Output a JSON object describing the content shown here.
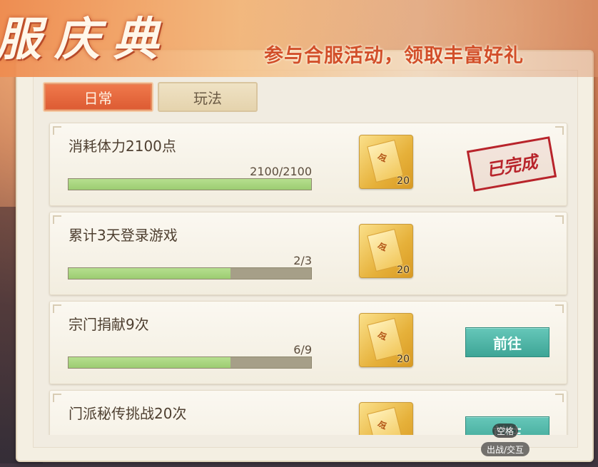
{
  "banner": {
    "title": "服庆典",
    "subtitle": "参与合服活动，领取丰富好礼"
  },
  "tabs": [
    {
      "label": "日常",
      "active": true
    },
    {
      "label": "玩法",
      "active": false
    }
  ],
  "tasks": [
    {
      "title": "消耗体力2100点",
      "progress_text": "2100/2100",
      "progress": 1.0,
      "reward_count": "20",
      "status": "completed",
      "stamp_text": "已完成"
    },
    {
      "title": "累计3天登录游戏",
      "progress_text": "2/3",
      "progress": 0.667,
      "reward_count": "20",
      "status": "in_progress"
    },
    {
      "title": "宗门捐献9次",
      "progress_text": "6/9",
      "progress": 0.667,
      "reward_count": "20",
      "status": "go",
      "button_label": "前往"
    },
    {
      "title": "门派秘传挑战20次",
      "progress_text": "",
      "progress": 0,
      "reward_count": "",
      "status": "go",
      "button_label": "前往"
    }
  ],
  "reward_icon": "gold-token-icon",
  "reward_mark": "令",
  "hints": {
    "key": "空格",
    "label": "出战/交互"
  },
  "colors": {
    "tab_active": "#e0623a",
    "progress_fill": "#a8d67e",
    "go_button": "#4fb3a5",
    "stamp": "#b8242b"
  }
}
